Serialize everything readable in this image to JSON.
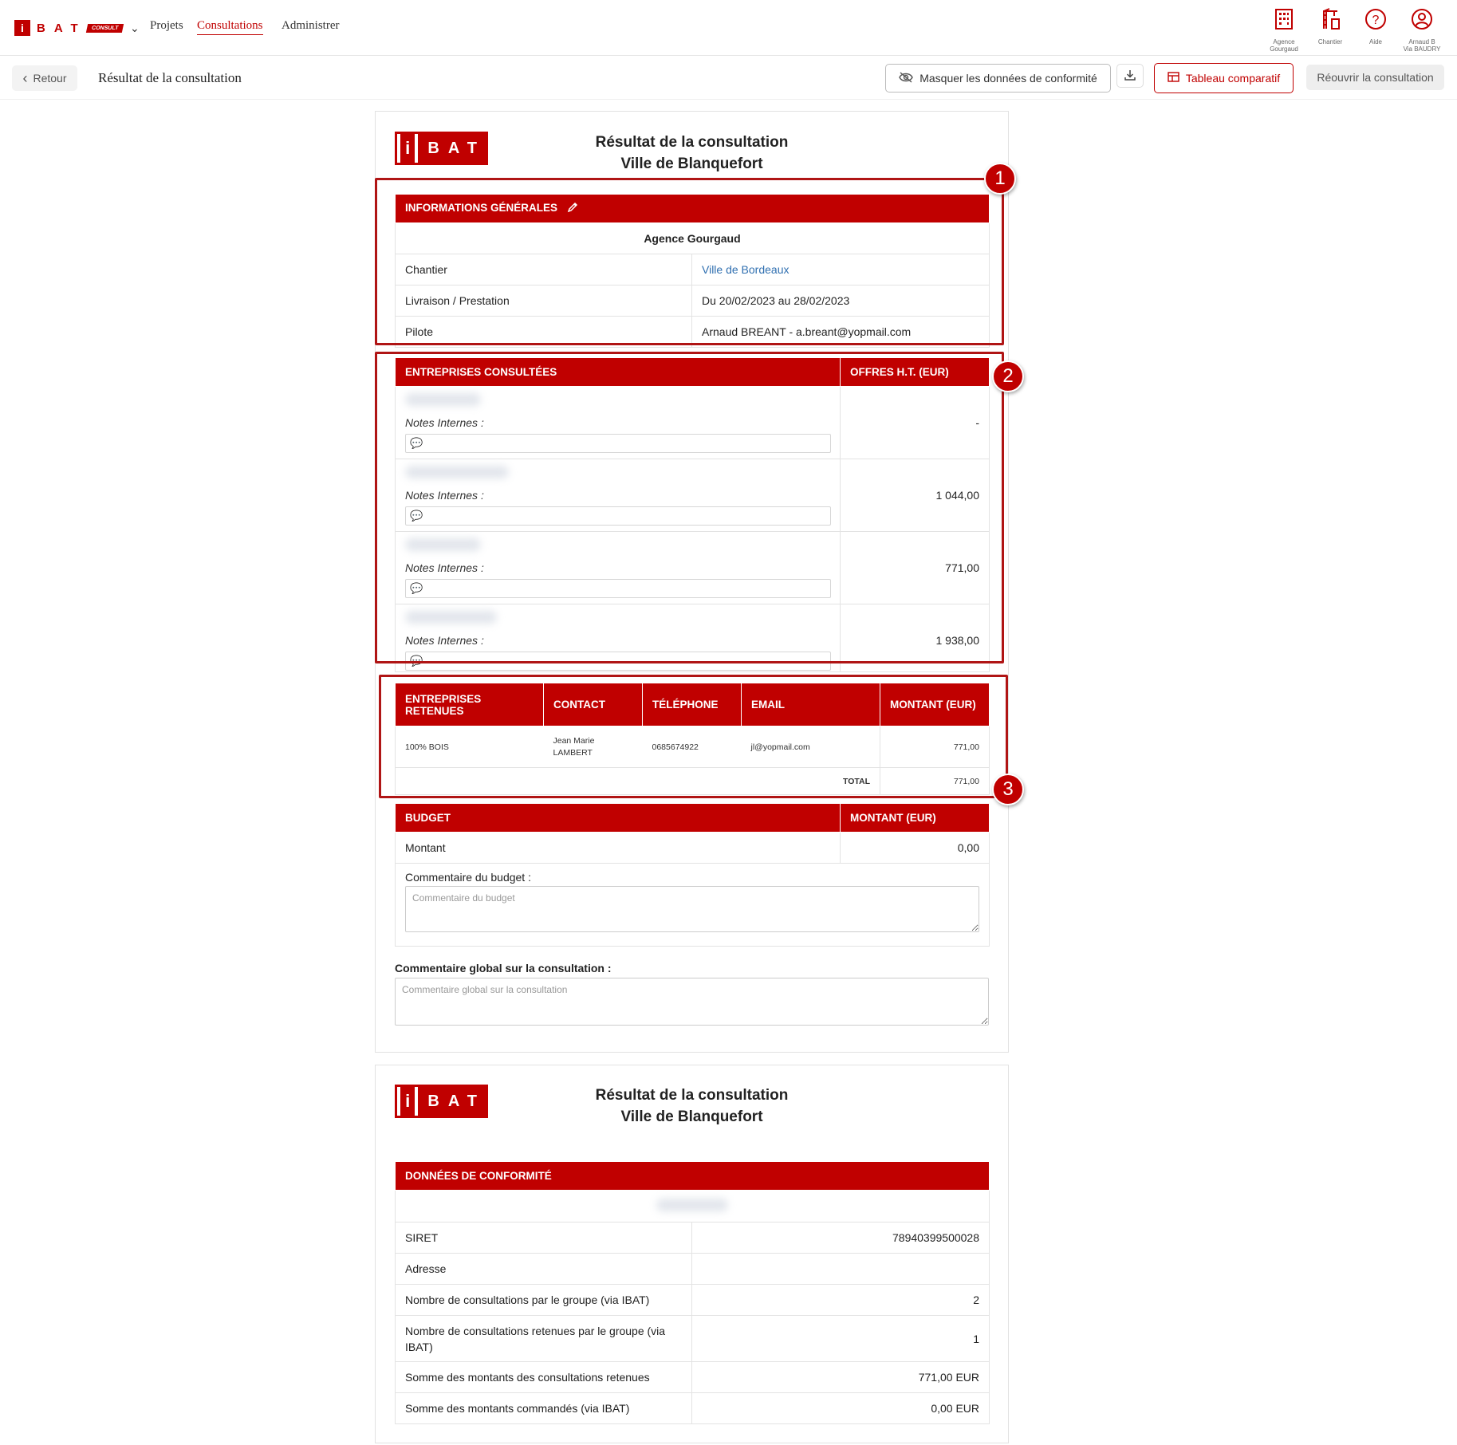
{
  "nav": {
    "brand_letters": "BAT",
    "brand_i": "i",
    "brand_consult": "CONSULT",
    "links": [
      "Projets",
      "Consultations",
      "Administrer"
    ],
    "icons": [
      {
        "name": "building-icon",
        "label1": "Agence",
        "label2": "Gourgaud"
      },
      {
        "name": "crane-icon",
        "label1": "Chantier",
        "label2": ""
      },
      {
        "name": "help-icon",
        "label1": "Aide",
        "label2": ""
      },
      {
        "name": "user-icon",
        "label1": "Arnaud B",
        "label2": "Via BAUDRY"
      }
    ]
  },
  "subheader": {
    "back": "Retour",
    "title": "Résultat de la consultation",
    "hide_compliance": "Masquer les données de conformité",
    "comparative": "Tableau comparatif",
    "reopen": "Réouvrir la consultation"
  },
  "doc": {
    "title_line1": "Résultat de la consultation",
    "title_line2": "Ville de Blanquefort",
    "logo_i": "i",
    "logo_rest": "BAT"
  },
  "general": {
    "header": "INFORMATIONS GÉNÉRALES",
    "agency": "Agence Gourgaud",
    "rows": [
      {
        "label": "Chantier",
        "value": "Ville de Bordeaux"
      },
      {
        "label": "Livraison / Prestation",
        "value": "Du 20/02/2023 au 28/02/2023"
      },
      {
        "label": "Pilote",
        "value": "Arnaud BREANT - a.breant@yopmail.com"
      }
    ]
  },
  "consulted": {
    "col1": "ENTREPRISES CONSULTÉES",
    "col2": "OFFRES H.T. (EUR)",
    "notes_label": "Notes Internes :",
    "offers": [
      "-",
      "1 044,00",
      "771,00",
      "1 938,00"
    ]
  },
  "retained": {
    "headers": [
      "ENTREPRISES RETENUES",
      "CONTACT",
      "TÉLÉPHONE",
      "EMAIL",
      "MONTANT (EUR)"
    ],
    "row": {
      "company": "100% BOIS",
      "contact": "Jean Marie LAMBERT",
      "phone": "0685674922",
      "email": "jl@yopmail.com",
      "amount": "771,00"
    },
    "total_label": "TOTAL",
    "total_value": "771,00"
  },
  "budget": {
    "col1": "BUDGET",
    "col2": "MONTANT (EUR)",
    "label": "Montant",
    "value": "0,00",
    "comment_label": "Commentaire du budget :",
    "comment_placeholder": "Commentaire du budget"
  },
  "global_comment": {
    "label": "Commentaire global sur la consultation :",
    "placeholder": "Commentaire global sur la consultation"
  },
  "compliance": {
    "header": "DONNÉES DE CONFORMITÉ",
    "rows": [
      {
        "label": "SIRET",
        "value": "78940399500028"
      },
      {
        "label": "Adresse",
        "value": ""
      },
      {
        "label": "Nombre de consultations par le groupe (via IBAT)",
        "value": "2"
      },
      {
        "label": "Nombre de consultations retenues par le groupe (via IBAT)",
        "value": "1"
      },
      {
        "label": "Somme des montants des consultations retenues",
        "value": "771,00 EUR"
      },
      {
        "label": "Somme des montants commandés (via IBAT)",
        "value": "0,00 EUR"
      }
    ]
  },
  "annotations": [
    "1",
    "2",
    "3"
  ],
  "colors": {
    "accent": "#c00000",
    "link": "#2f6fb0"
  }
}
